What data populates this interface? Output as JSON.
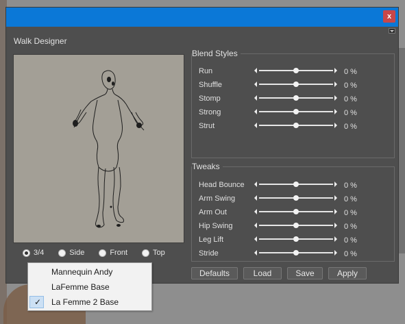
{
  "window": {
    "title": "Walk Designer",
    "close_label": "x"
  },
  "blend_styles": {
    "title": "Blend Styles",
    "sliders": [
      {
        "label": "Run",
        "value": "0 %",
        "fraction": 0.5
      },
      {
        "label": "Shuffle",
        "value": "0 %",
        "fraction": 0.5
      },
      {
        "label": "Stomp",
        "value": "0 %",
        "fraction": 0.5
      },
      {
        "label": "Strong",
        "value": "0 %",
        "fraction": 0.5
      },
      {
        "label": "Strut",
        "value": "0 %",
        "fraction": 0.5
      }
    ]
  },
  "tweaks": {
    "title": "Tweaks",
    "sliders": [
      {
        "label": "Head Bounce",
        "value": "0 %",
        "fraction": 0.5
      },
      {
        "label": "Arm Swing",
        "value": "0 %",
        "fraction": 0.5
      },
      {
        "label": "Arm Out",
        "value": "0 %",
        "fraction": 0.5
      },
      {
        "label": "Hip Swing",
        "value": "0 %",
        "fraction": 0.5
      },
      {
        "label": "Leg Lift",
        "value": "0 %",
        "fraction": 0.5
      },
      {
        "label": "Stride",
        "value": "0 %",
        "fraction": 0.5
      }
    ]
  },
  "views": [
    {
      "label": "3/4",
      "selected": true
    },
    {
      "label": "Side",
      "selected": false
    },
    {
      "label": "Front",
      "selected": false
    },
    {
      "label": "Top",
      "selected": false
    }
  ],
  "buttons": {
    "defaults": "Defaults",
    "load": "Load",
    "save": "Save",
    "apply": "Apply"
  },
  "figure_menu": {
    "items": [
      {
        "label": "Mannequin Andy",
        "checked": false
      },
      {
        "label": "LaFemme Base",
        "checked": false
      },
      {
        "label": "La Femme 2 Base",
        "checked": true
      }
    ],
    "check_icon": "checkmark-icon"
  },
  "colors": {
    "titlebar": "#0b78d7",
    "close_button": "#c8474a",
    "panel": "#4e4e4e",
    "preview_bg": "#a39f96"
  }
}
